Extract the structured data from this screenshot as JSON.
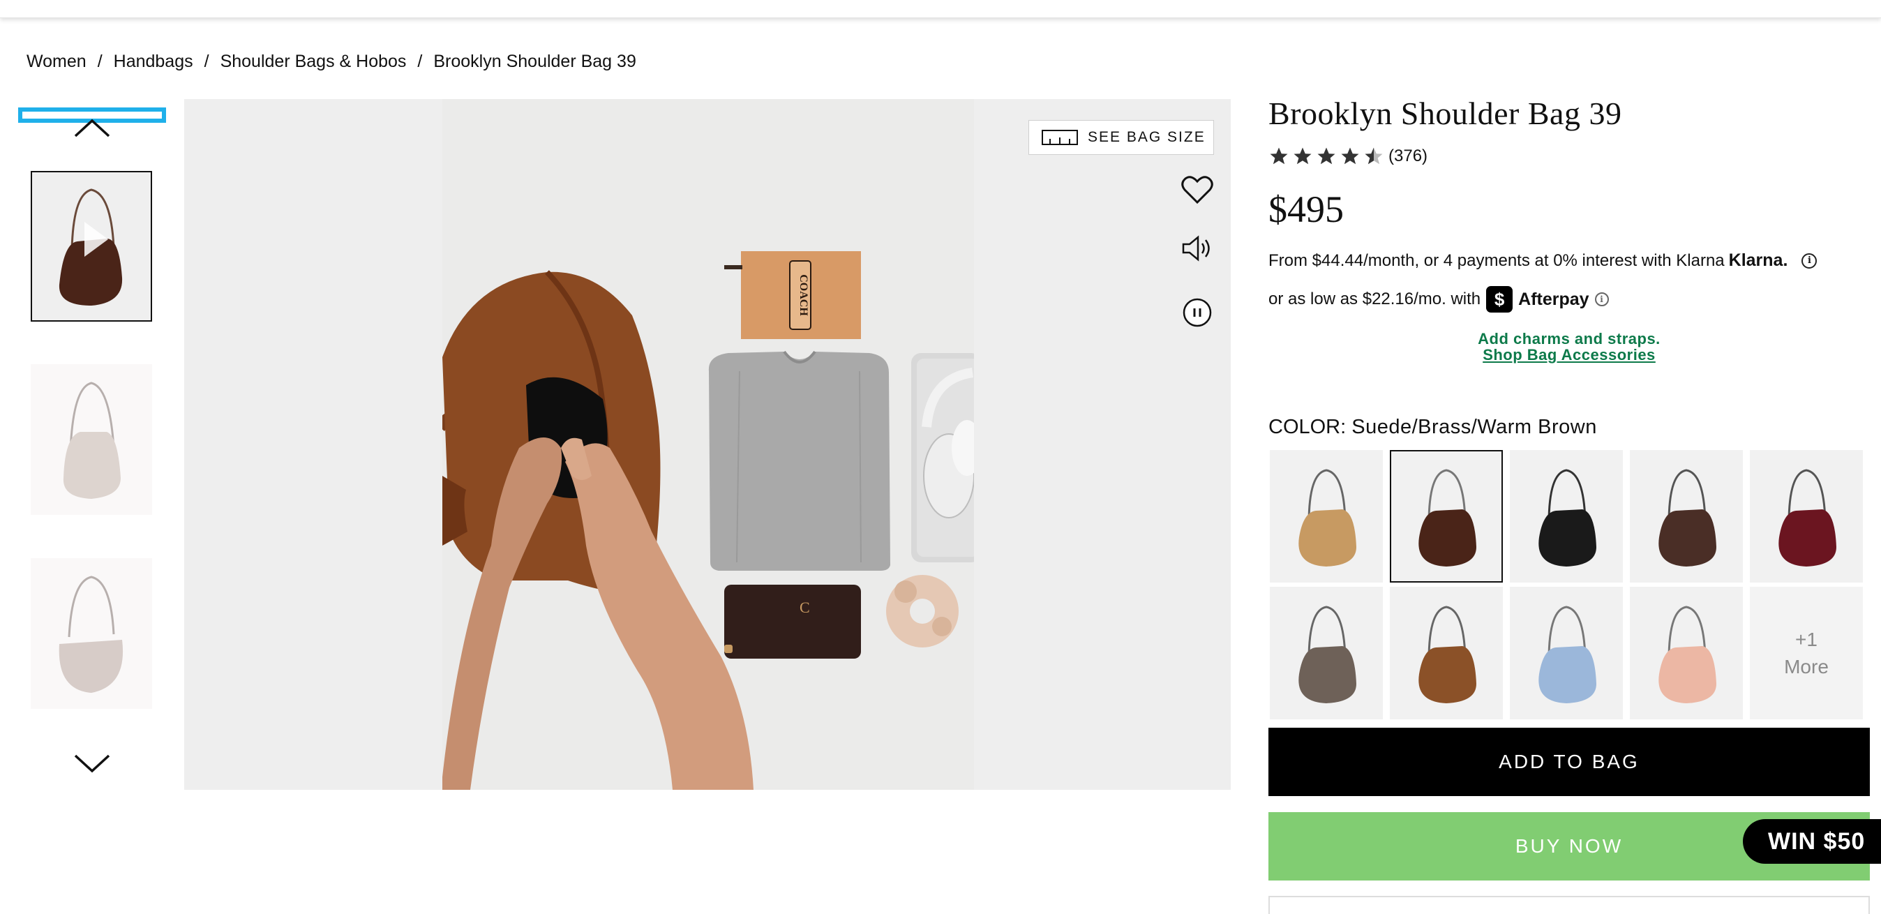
{
  "breadcrumb": [
    "Women",
    "Handbags",
    "Shoulder Bags & Hobos",
    "Brooklyn Shoulder Bag 39"
  ],
  "media": {
    "size_button_label": "SEE BAG SIZE",
    "wordmark": "COACH"
  },
  "product": {
    "title": "Brooklyn Shoulder Bag 39",
    "rating": 4.5,
    "review_count": "(376)",
    "price": "$495",
    "klarna_text": "From $44.44/month, or 4 payments at 0% interest with Klarna",
    "klarna_brand": "Klarna.",
    "afterpay_text": "or as low as $22.16/mo. with",
    "afterpay_brand": "Afterpay",
    "charms_text": "Add charms and straps.",
    "charms_link": "Shop Bag Accessories",
    "color_label": "COLOR:",
    "color_value": "Suede/Brass/Warm Brown"
  },
  "swatches": [
    {
      "color": "#c79a62"
    },
    {
      "color": "#4a2418",
      "selected": true
    },
    {
      "color": "#1a1a1a"
    },
    {
      "color": "#4a2e26"
    },
    {
      "color": "#6b1520"
    },
    {
      "color": "#6e6158"
    },
    {
      "color": "#8b5128"
    },
    {
      "color": "#9bb7da"
    },
    {
      "color": "#ecb7a4"
    }
  ],
  "more_swatch": {
    "count": "+1",
    "label": "More"
  },
  "thumbs": [
    {
      "color": "#4a2418"
    },
    {
      "color": "#c3b1a9"
    },
    {
      "color": "#b7a39c"
    }
  ],
  "actions": {
    "add_to_bag": "ADD TO BAG",
    "buy_now": "BUY NOW",
    "win_badge": "WIN $50"
  }
}
